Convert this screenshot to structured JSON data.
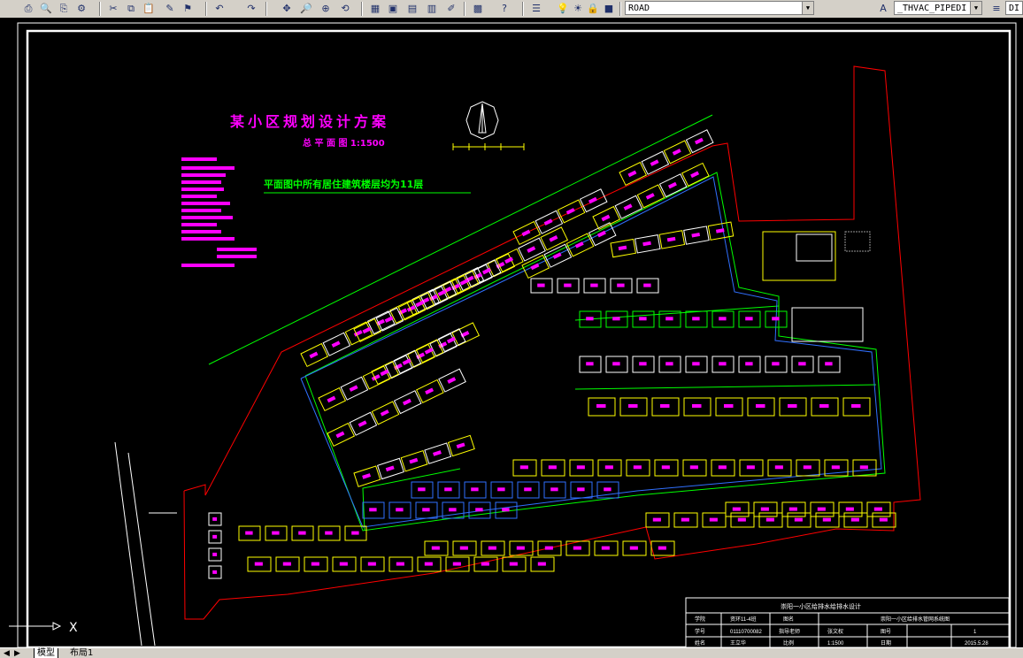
{
  "toolbar": {
    "layer_combo": "ROAD",
    "style_combo": "_THVAC_PIPEDI",
    "right_combo": "DI",
    "icons": [
      "print-icon",
      "preview-icon",
      "publish-icon",
      "plot-icon",
      "cut-icon",
      "copy-icon",
      "paste-icon",
      "brush-icon",
      "match-icon",
      "undo-icon",
      "redo-icon",
      "pan-icon",
      "zoom-realtime-icon",
      "zoom-window-icon",
      "zoom-previous-icon",
      "properties-icon",
      "design-center-icon",
      "tool-palettes-icon",
      "sheet-set-icon",
      "markup-icon",
      "calculator-icon",
      "help-icon",
      "layers-icon",
      "bulb-icon",
      "sun-icon",
      "lock-icon",
      "color-icon",
      "text-style-icon",
      "dim-style-icon"
    ]
  },
  "drawing": {
    "title": "某小区规划设计方案",
    "subtitle": "总 平 面 图   1:1500",
    "note": "平面图中所有居住建筑楼层均为11层"
  },
  "title_block": {
    "header": "崇阳一小区给排水给排水设计",
    "row1": [
      "学院",
      "资环11-4班",
      "图名",
      "崇阳一小区给排水管网系统图"
    ],
    "row2": [
      "学号",
      "01110700082",
      "指导老师",
      "张文权",
      "图号",
      "1"
    ],
    "row3": [
      "姓名",
      "王立华",
      "比例",
      "1:1500",
      "日期",
      "2015.5.28"
    ]
  },
  "colors": {
    "background": "#000000",
    "buildings": "#ffffff",
    "road": "#ffff00",
    "pipe": "#00ff00",
    "label": "#ff00ff",
    "boundary": "#ff0000",
    "blue": "#3070ff"
  },
  "statusbar": {
    "tab_model": "模型",
    "tab_layout": "布局1"
  }
}
